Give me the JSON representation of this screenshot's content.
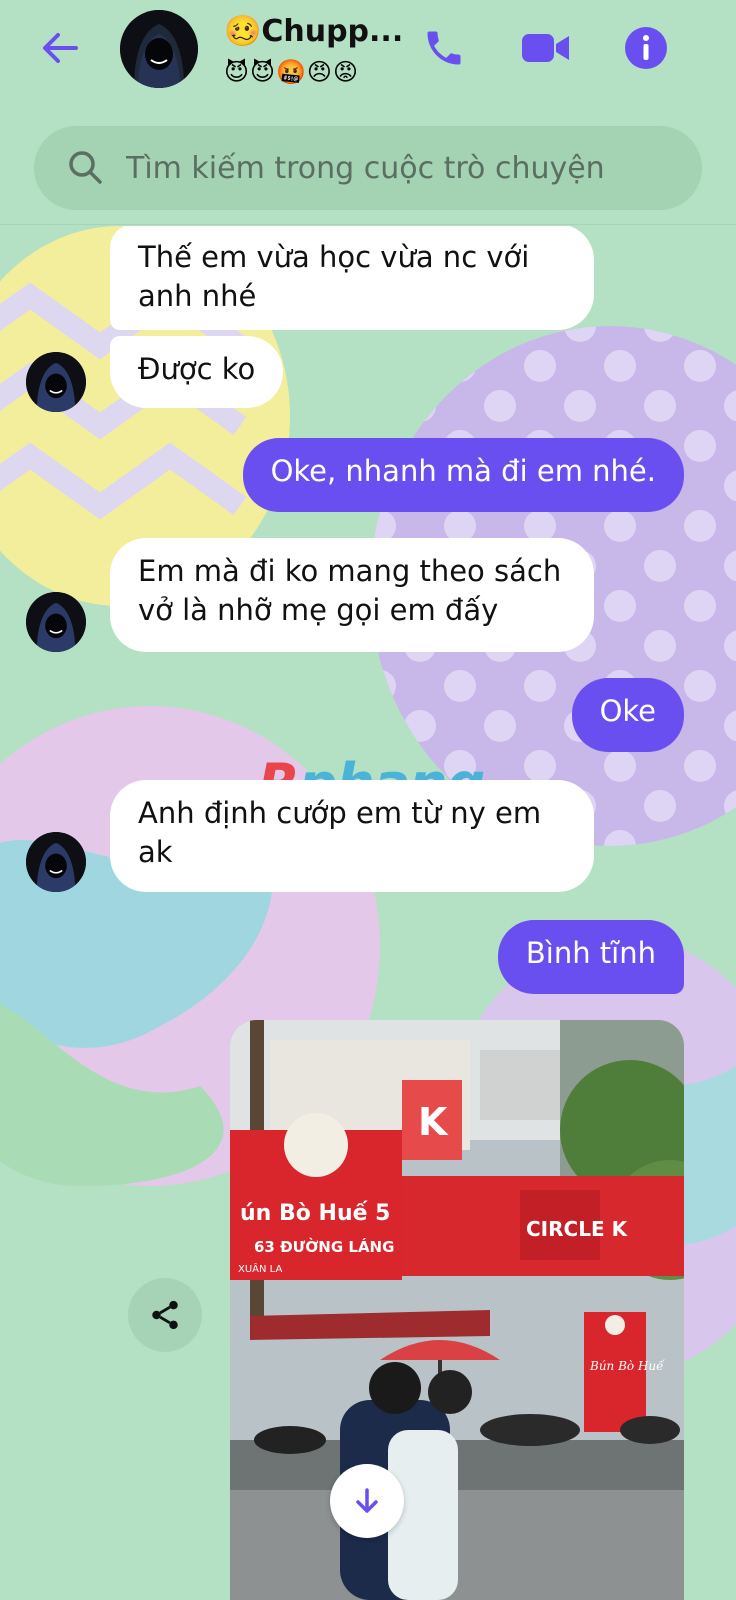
{
  "header": {
    "title": "🥴Chupp...",
    "status_emojis": "😈😈🤬😠😡"
  },
  "search": {
    "placeholder": "Tìm kiếm trong cuộc trò chuyện"
  },
  "messages": [
    {
      "side": "in",
      "text": "Thế em vừa học vừa nc với anh nhé"
    },
    {
      "side": "in",
      "text": "Được ko"
    },
    {
      "side": "out",
      "text": "Oke, nhanh mà đi em nhé."
    },
    {
      "side": "in",
      "text": "Em mà đi ko mang theo sách vở là nhỡ mẹ gọi em đấy"
    },
    {
      "side": "out",
      "text": "Oke"
    },
    {
      "side": "in",
      "text": "Anh định cướp em từ ny em ak"
    },
    {
      "side": "out",
      "text": "Bình tĩnh"
    }
  ],
  "watermark": {
    "first": "R",
    "rest": "phang"
  },
  "photo": {
    "sign_main": "ún Bò Huế 5",
    "sign_sub": "63 ĐƯỜNG LÁNG",
    "sign_area": "XUÂN LA",
    "store": "CIRCLE K",
    "vertical_sign": "Bún Bò Huế",
    "banner_k": "K"
  },
  "colors": {
    "background": "#b4e0c3",
    "accent": "#6a4ff0",
    "outgoing_bubble": "#6a4ff0",
    "incoming_bubble": "#ffffff"
  }
}
